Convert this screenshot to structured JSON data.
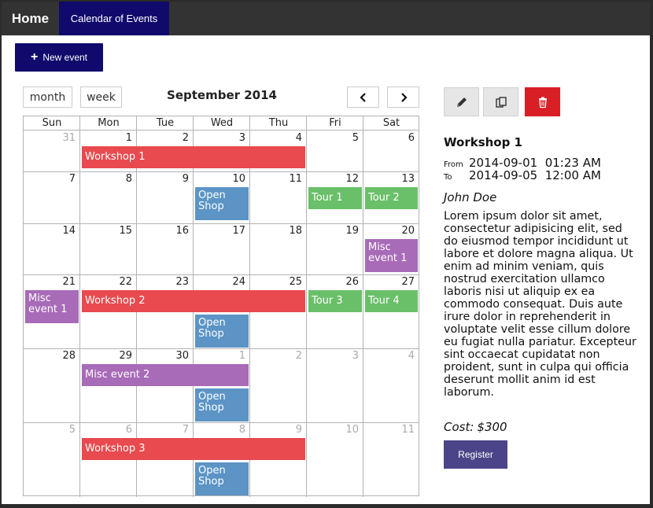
{
  "nav": {
    "home": "Home",
    "calendar": "Calendar of Events"
  },
  "toolbar": {
    "new_event": "New event",
    "month": "month",
    "week": "week"
  },
  "calendar": {
    "title": "September 2014",
    "weekdays": [
      "Sun",
      "Mon",
      "Tue",
      "Wed",
      "Thu",
      "Fri",
      "Sat"
    ],
    "weeks": [
      {
        "days": [
          {
            "n": "31",
            "cur": false
          },
          {
            "n": "1",
            "cur": true
          },
          {
            "n": "2",
            "cur": true
          },
          {
            "n": "3",
            "cur": true
          },
          {
            "n": "4",
            "cur": true
          },
          {
            "n": "5",
            "cur": true
          },
          {
            "n": "6",
            "cur": true
          }
        ],
        "events": [
          {
            "title": "Workshop 1",
            "start": 1,
            "span": 4,
            "row": 0,
            "lines": 1,
            "color": "#e84a4f"
          }
        ]
      },
      {
        "days": [
          {
            "n": "7",
            "cur": true
          },
          {
            "n": "8",
            "cur": true
          },
          {
            "n": "9",
            "cur": true
          },
          {
            "n": "10",
            "cur": true
          },
          {
            "n": "11",
            "cur": true
          },
          {
            "n": "12",
            "cur": true
          },
          {
            "n": "13",
            "cur": true
          }
        ],
        "events": [
          {
            "title": "Open Shop",
            "start": 3,
            "span": 1,
            "row": 0,
            "lines": 2,
            "color": "#5b94c5"
          },
          {
            "title": "Tour 1",
            "start": 5,
            "span": 1,
            "row": 0,
            "lines": 1,
            "color": "#6abf69"
          },
          {
            "title": "Tour 2",
            "start": 6,
            "span": 1,
            "row": 0,
            "lines": 1,
            "color": "#6abf69"
          }
        ]
      },
      {
        "days": [
          {
            "n": "14",
            "cur": true
          },
          {
            "n": "15",
            "cur": true
          },
          {
            "n": "16",
            "cur": true
          },
          {
            "n": "17",
            "cur": true
          },
          {
            "n": "18",
            "cur": true
          },
          {
            "n": "19",
            "cur": true
          },
          {
            "n": "20",
            "cur": true
          }
        ],
        "events": [
          {
            "title": "Misc event 1",
            "start": 6,
            "span": 1,
            "row": 0,
            "lines": 2,
            "color": "#a86bb8"
          }
        ]
      },
      {
        "days": [
          {
            "n": "21",
            "cur": true
          },
          {
            "n": "22",
            "cur": true
          },
          {
            "n": "23",
            "cur": true
          },
          {
            "n": "24",
            "cur": true
          },
          {
            "n": "25",
            "cur": true
          },
          {
            "n": "26",
            "cur": true
          },
          {
            "n": "27",
            "cur": true
          }
        ],
        "events": [
          {
            "title": "Misc event 1",
            "start": 0,
            "span": 1,
            "row": 0,
            "lines": 2,
            "color": "#a86bb8"
          },
          {
            "title": "Workshop 2",
            "start": 1,
            "span": 4,
            "row": 0,
            "lines": 1,
            "color": "#e84a4f"
          },
          {
            "title": "Tour 3",
            "start": 5,
            "span": 1,
            "row": 0,
            "lines": 1,
            "color": "#6abf69"
          },
          {
            "title": "Tour 4",
            "start": 6,
            "span": 1,
            "row": 0,
            "lines": 1,
            "color": "#6abf69"
          },
          {
            "title": "Open Shop",
            "start": 3,
            "span": 1,
            "row": 1,
            "lines": 2,
            "color": "#5b94c5"
          }
        ]
      },
      {
        "days": [
          {
            "n": "28",
            "cur": true
          },
          {
            "n": "29",
            "cur": true
          },
          {
            "n": "30",
            "cur": true
          },
          {
            "n": "1",
            "cur": false
          },
          {
            "n": "2",
            "cur": false
          },
          {
            "n": "3",
            "cur": false
          },
          {
            "n": "4",
            "cur": false
          }
        ],
        "events": [
          {
            "title": "Misc event 2",
            "start": 1,
            "span": 3,
            "row": 0,
            "lines": 1,
            "color": "#a86bb8"
          },
          {
            "title": "Open Shop",
            "start": 3,
            "span": 1,
            "row": 1,
            "lines": 2,
            "color": "#5b94c5"
          }
        ]
      },
      {
        "days": [
          {
            "n": "5",
            "cur": false
          },
          {
            "n": "6",
            "cur": false
          },
          {
            "n": "7",
            "cur": false
          },
          {
            "n": "8",
            "cur": false
          },
          {
            "n": "9",
            "cur": false
          },
          {
            "n": "10",
            "cur": false
          },
          {
            "n": "11",
            "cur": false
          }
        ],
        "events": [
          {
            "title": "Workshop 3",
            "start": 1,
            "span": 4,
            "row": 0,
            "lines": 1,
            "color": "#e84a4f"
          },
          {
            "title": "Open Shop",
            "start": 3,
            "span": 1,
            "row": 1,
            "lines": 2,
            "color": "#5b94c5"
          }
        ]
      }
    ]
  },
  "detail": {
    "title": "Workshop 1",
    "from_label": "From",
    "from_value": "2014-09-01  01:23 AM",
    "to_label": "To",
    "to_value": "2014-09-05  12:00 AM",
    "person": "John Doe",
    "description": "Lorem ipsum dolor sit amet, consectetur adipisicing elit, sed do eiusmod tempor incididunt ut labore et dolore magna aliqua. Ut enim ad minim veniam, quis nostrud exercitation ullamco laboris nisi ut aliquip ex ea commodo consequat. Duis aute irure dolor in reprehenderit in voluptate velit esse cillum dolore eu fugiat nulla pariatur. Excepteur sint occaecat cupidatat non proident, sunt in culpa qui officia deserunt mollit anim id est laborum.",
    "cost_label": "Cost:",
    "cost_value": "$300",
    "register": "Register"
  },
  "icons": {
    "plus": "plus-icon",
    "prev": "chevron-left-icon",
    "next": "chevron-right-icon",
    "edit": "pencil-icon",
    "copy": "copy-icon",
    "delete": "trash-icon"
  },
  "colors": {
    "nav_bg": "#333333",
    "active_nav": "#0f0a6b",
    "new_btn": "#0f0a6b",
    "register_btn": "#4b4488",
    "delete_btn": "#d81f26",
    "tool_btn": "#e6e6e6"
  }
}
